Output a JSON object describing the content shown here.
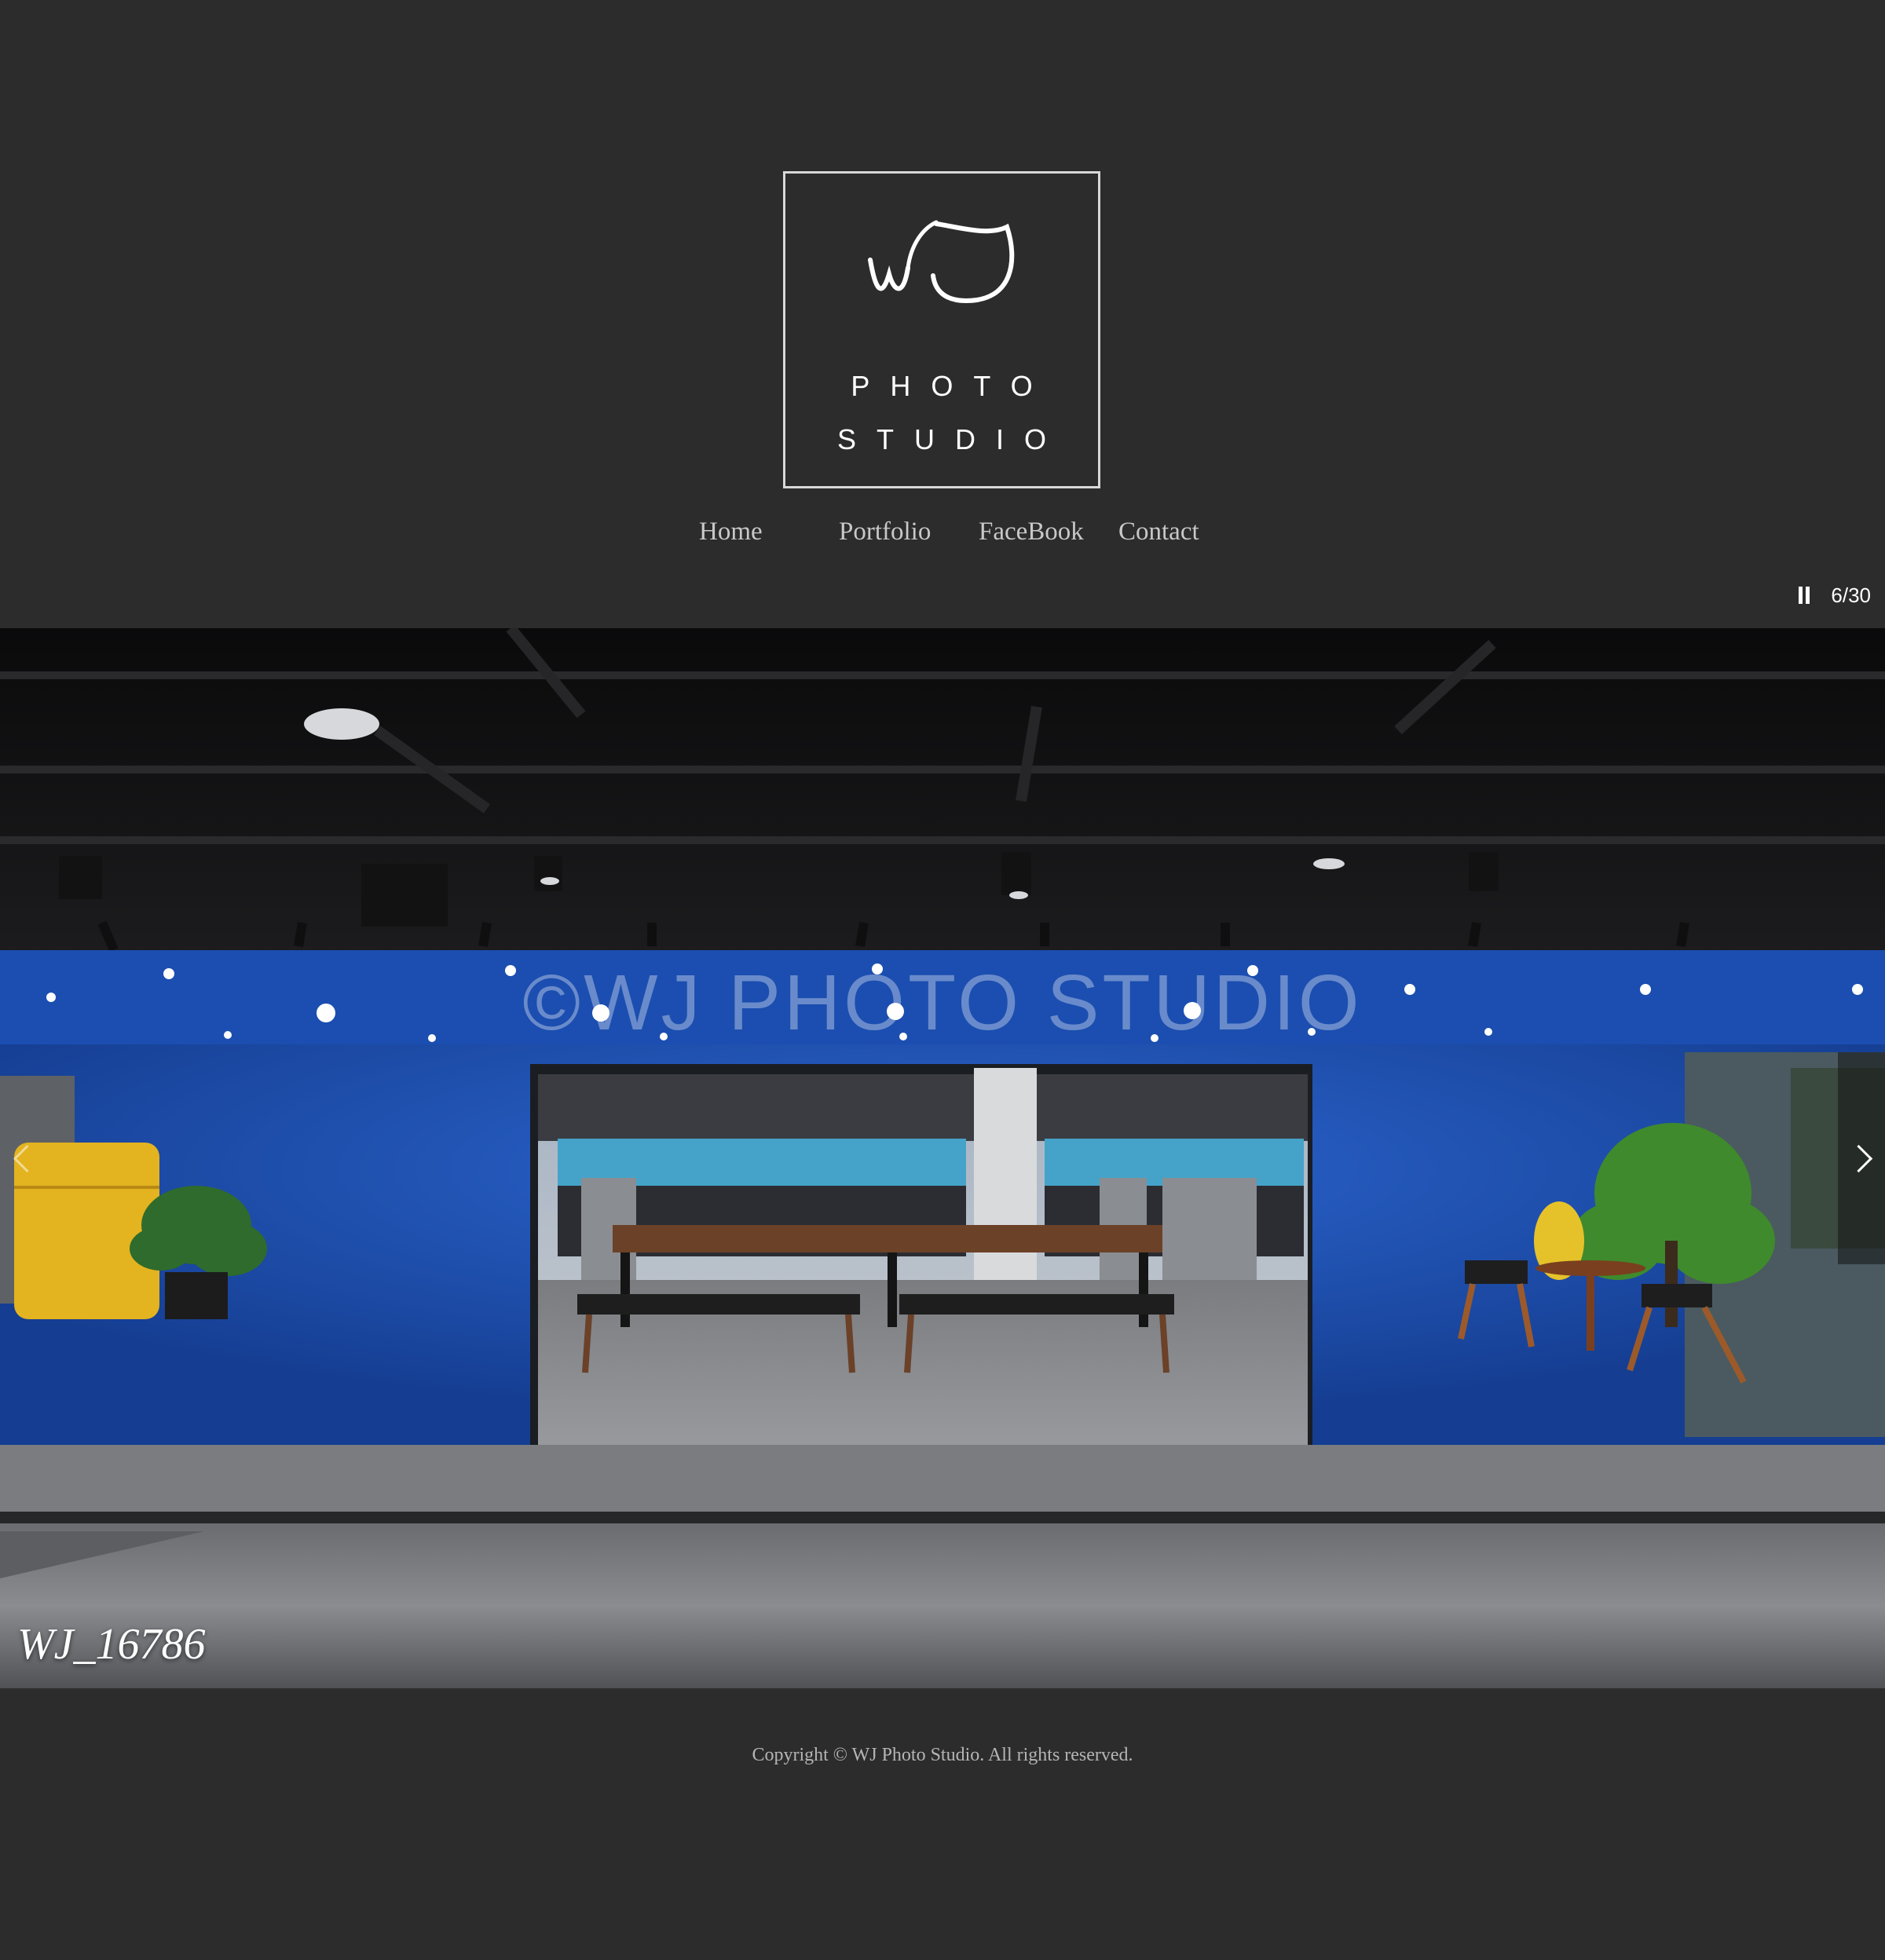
{
  "logo": {
    "mark": "WJ",
    "line1": "PHOTO",
    "line2": "STUDIO"
  },
  "nav": {
    "items": [
      {
        "label": "Home"
      },
      {
        "label": "Portfolio"
      },
      {
        "label": "FaceBook"
      },
      {
        "label": "Contact"
      }
    ]
  },
  "slideshow": {
    "counter": "6/30",
    "caption": "WJ_16786",
    "watermark": "©WJ PHOTO STUDIO",
    "pause_icon": "pause-icon",
    "prev_icon": "chevron-left-icon",
    "next_icon": "chevron-right-icon"
  },
  "footer": {
    "copyright": "Copyright © WJ Photo Studio. All rights reserved."
  },
  "colors": {
    "background": "#2c2c2c",
    "text": "#c8c8c8",
    "photo_wall_blue": "#1f4fa8",
    "fridge_yellow": "#e3b320"
  }
}
